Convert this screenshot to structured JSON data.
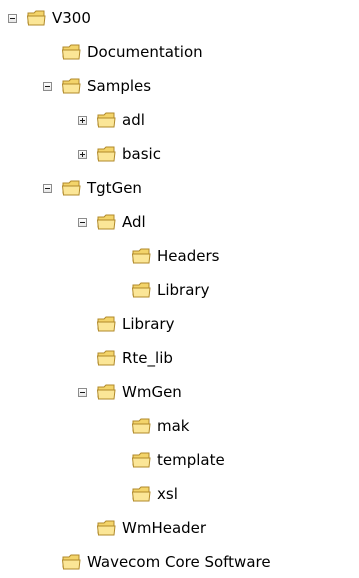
{
  "tree": {
    "items": [
      {
        "label": "V300",
        "depth": 0,
        "toggle": "minus"
      },
      {
        "label": "Documentation",
        "depth": 1,
        "toggle": "none"
      },
      {
        "label": "Samples",
        "depth": 1,
        "toggle": "minus"
      },
      {
        "label": "adl",
        "depth": 2,
        "toggle": "plus"
      },
      {
        "label": "basic",
        "depth": 2,
        "toggle": "plus"
      },
      {
        "label": "TgtGen",
        "depth": 1,
        "toggle": "minus"
      },
      {
        "label": "Adl",
        "depth": 2,
        "toggle": "minus"
      },
      {
        "label": "Headers",
        "depth": 3,
        "toggle": "none"
      },
      {
        "label": "Library",
        "depth": 3,
        "toggle": "none"
      },
      {
        "label": "Library",
        "depth": 2,
        "toggle": "none"
      },
      {
        "label": "Rte_lib",
        "depth": 2,
        "toggle": "none"
      },
      {
        "label": "WmGen",
        "depth": 2,
        "toggle": "minus"
      },
      {
        "label": "mak",
        "depth": 3,
        "toggle": "none"
      },
      {
        "label": "template",
        "depth": 3,
        "toggle": "none"
      },
      {
        "label": "xsl",
        "depth": 3,
        "toggle": "none"
      },
      {
        "label": "WmHeader",
        "depth": 2,
        "toggle": "none"
      },
      {
        "label": "Wavecom Core Software",
        "depth": 1,
        "toggle": "none"
      }
    ]
  },
  "colors": {
    "folder_body": "#f3d46a",
    "folder_front": "#fbe697",
    "folder_outline": "#b0892a",
    "toggle_border": "#8c8c8c",
    "text": "#000000"
  },
  "icons": {
    "folder": "folder-icon",
    "expand": "plus-box-icon",
    "collapse": "minus-box-icon"
  }
}
